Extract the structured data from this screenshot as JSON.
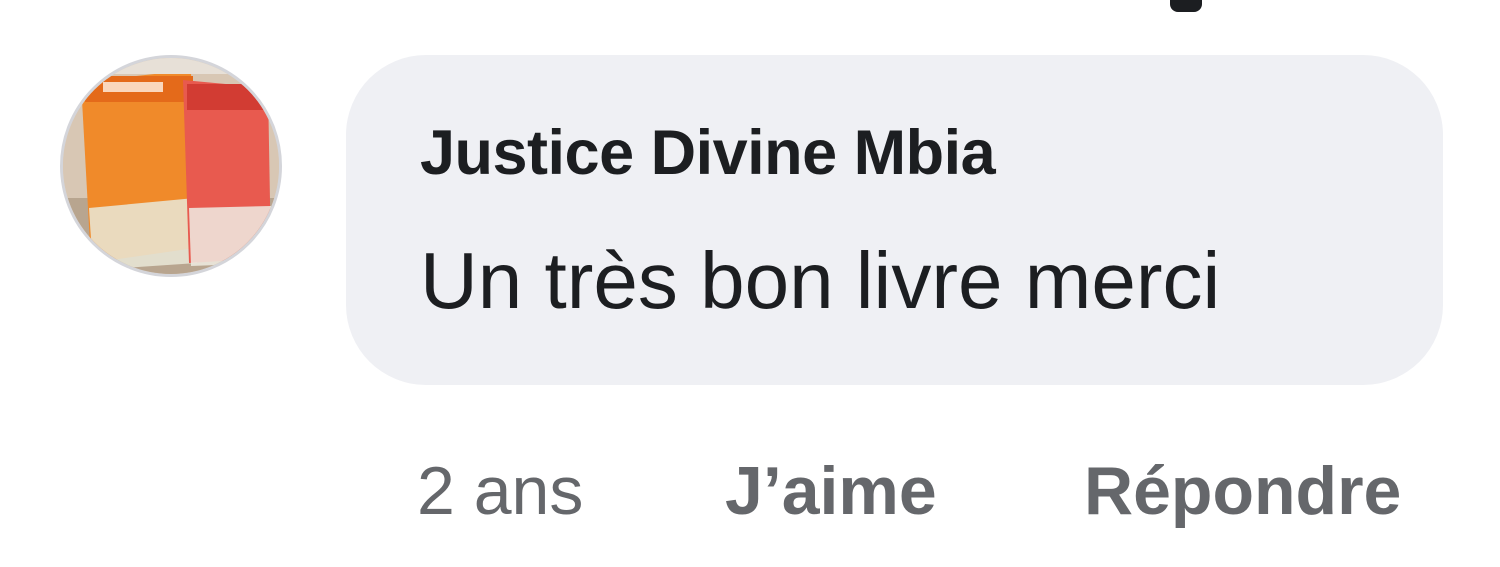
{
  "comment": {
    "author": "Justice Divine Mbia",
    "text": "Un très bon livre merci",
    "avatar_icon": "profile-photo-skincare-tubes",
    "bubble_color": "#eff0f4"
  },
  "actions": {
    "timestamp": "2 ans",
    "like_label": "J’aime",
    "reply_label": "Répondre"
  },
  "colors": {
    "text_primary": "#1c1e21",
    "text_secondary": "#65676b"
  }
}
